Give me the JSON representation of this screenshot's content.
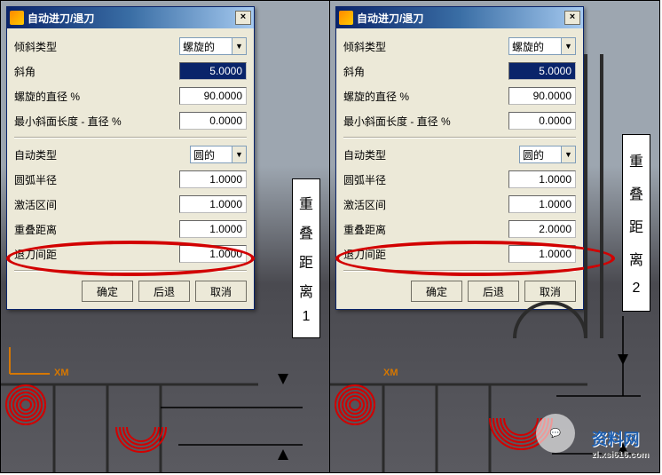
{
  "left": {
    "dialog": {
      "title": "自动进刀/退刀",
      "tilt_type_label": "倾斜类型",
      "tilt_type_value": "螺旋的",
      "angle_label": "斜角",
      "angle_value": "5.0000",
      "helix_dia_label": "螺旋的直径 %",
      "helix_dia_value": "90.0000",
      "min_ramp_label": "最小斜面长度 - 直径 %",
      "min_ramp_value": "0.0000",
      "auto_type_label": "自动类型",
      "auto_type_value": "圆的",
      "arc_radius_label": "圆弧半径",
      "arc_radius_value": "1.0000",
      "active_zone_label": "激活区间",
      "active_zone_value": "1.0000",
      "overlap_label": "重叠距离",
      "overlap_value": "1.0000",
      "retract_label": "退刀间距",
      "retract_value": "1.0000",
      "ok": "确定",
      "back": "后退",
      "cancel": "取消"
    },
    "side_label": [
      "重",
      "叠",
      "距",
      "离",
      "1"
    ],
    "xm": "XM"
  },
  "right": {
    "dialog": {
      "title": "自动进刀/退刀",
      "tilt_type_label": "倾斜类型",
      "tilt_type_value": "螺旋的",
      "angle_label": "斜角",
      "angle_value": "5.0000",
      "helix_dia_label": "螺旋的直径 %",
      "helix_dia_value": "90.0000",
      "min_ramp_label": "最小斜面长度 - 直径 %",
      "min_ramp_value": "0.0000",
      "auto_type_label": "自动类型",
      "auto_type_value": "圆的",
      "arc_radius_label": "圆弧半径",
      "arc_radius_value": "1.0000",
      "active_zone_label": "激活区间",
      "active_zone_value": "1.0000",
      "overlap_label": "重叠距离",
      "overlap_value": "2.0000",
      "retract_label": "退刀间距",
      "retract_value": "1.0000",
      "ok": "确定",
      "back": "后退",
      "cancel": "取消"
    },
    "side_label": [
      "重",
      "叠",
      "距",
      "离",
      "2"
    ],
    "xm": "XM"
  },
  "watermark": {
    "brand": "资料网",
    "url": "zl.xsi616.com"
  }
}
